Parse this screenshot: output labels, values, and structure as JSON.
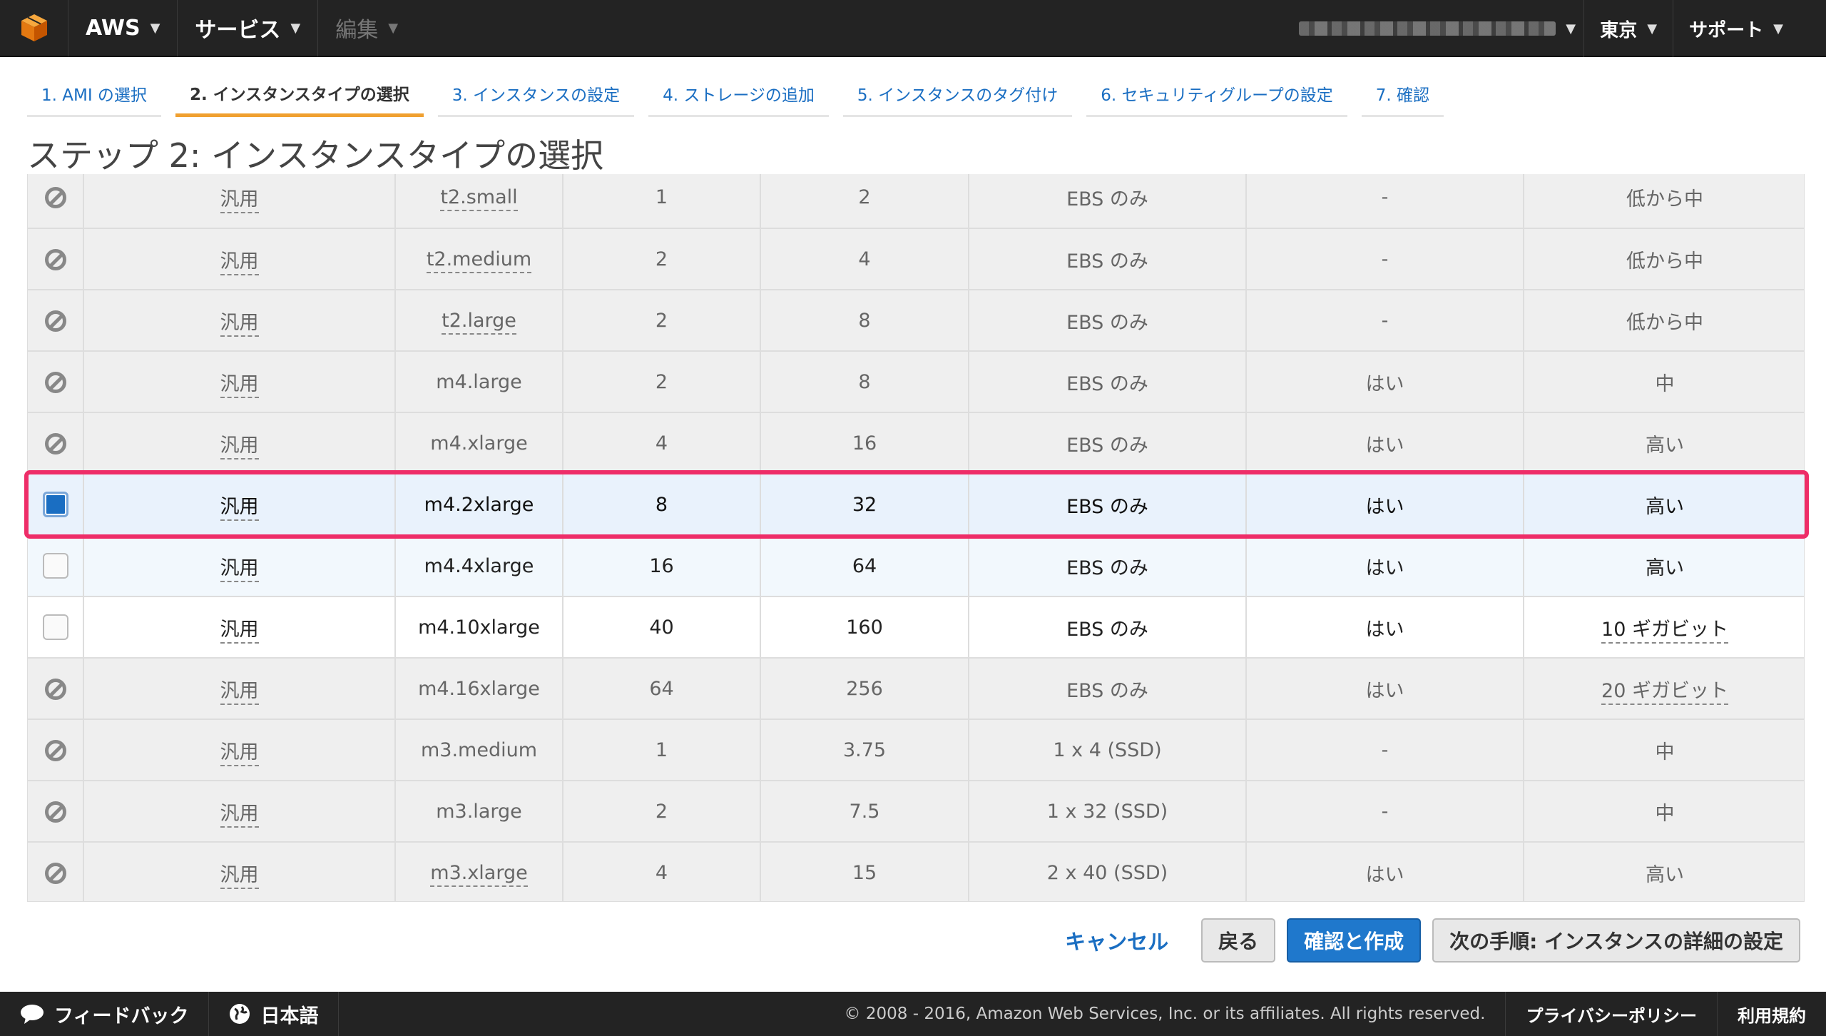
{
  "nav": {
    "aws_label": "AWS",
    "services_label": "サービス",
    "edit_label": "編集",
    "region_label": "東京",
    "support_label": "サポート"
  },
  "steps": [
    "1. AMI の選択",
    "2. インスタンスタイプの選択",
    "3. インスタンスの設定",
    "4. ストレージの追加",
    "5. インスタンスのタグ付け",
    "6. セキュリティグループの設定",
    "7. 確認"
  ],
  "page_title": "ステップ 2: インスタンスタイプの選択",
  "rows": [
    {
      "state": "disabled",
      "family": "汎用",
      "type": "t2.small",
      "vcpu": "1",
      "memory": "2",
      "storage": "EBS のみ",
      "ebs_opt": "-",
      "network": "低から中"
    },
    {
      "state": "disabled",
      "family": "汎用",
      "type": "t2.medium",
      "vcpu": "2",
      "memory": "4",
      "storage": "EBS のみ",
      "ebs_opt": "-",
      "network": "低から中"
    },
    {
      "state": "disabled",
      "family": "汎用",
      "type": "t2.large",
      "vcpu": "2",
      "memory": "8",
      "storage": "EBS のみ",
      "ebs_opt": "-",
      "network": "低から中"
    },
    {
      "state": "disabled",
      "family": "汎用",
      "type": "m4.large",
      "vcpu": "2",
      "memory": "8",
      "storage": "EBS のみ",
      "ebs_opt": "はい",
      "network": "中"
    },
    {
      "state": "disabled",
      "family": "汎用",
      "type": "m4.xlarge",
      "vcpu": "4",
      "memory": "16",
      "storage": "EBS のみ",
      "ebs_opt": "はい",
      "network": "高い"
    },
    {
      "state": "selected",
      "family": "汎用",
      "type": "m4.2xlarge",
      "vcpu": "8",
      "memory": "32",
      "storage": "EBS のみ",
      "ebs_opt": "はい",
      "network": "高い"
    },
    {
      "state": "hover",
      "family": "汎用",
      "type": "m4.4xlarge",
      "vcpu": "16",
      "memory": "64",
      "storage": "EBS のみ",
      "ebs_opt": "はい",
      "network": "高い"
    },
    {
      "state": "normal",
      "family": "汎用",
      "type": "m4.10xlarge",
      "vcpu": "40",
      "memory": "160",
      "storage": "EBS のみ",
      "ebs_opt": "はい",
      "network": "10 ギガビット"
    },
    {
      "state": "disabled",
      "family": "汎用",
      "type": "m4.16xlarge",
      "vcpu": "64",
      "memory": "256",
      "storage": "EBS のみ",
      "ebs_opt": "はい",
      "network": "20 ギガビット"
    },
    {
      "state": "disabled",
      "family": "汎用",
      "type": "m3.medium",
      "vcpu": "1",
      "memory": "3.75",
      "storage": "1 x 4 (SSD)",
      "ebs_opt": "-",
      "network": "中"
    },
    {
      "state": "disabled",
      "family": "汎用",
      "type": "m3.large",
      "vcpu": "2",
      "memory": "7.5",
      "storage": "1 x 32 (SSD)",
      "ebs_opt": "-",
      "network": "中"
    },
    {
      "state": "disabled",
      "family": "汎用",
      "type": "m3.xlarge",
      "vcpu": "4",
      "memory": "15",
      "storage": "2 x 40 (SSD)",
      "ebs_opt": "はい",
      "network": "高い"
    }
  ],
  "buttons": {
    "cancel": "キャンセル",
    "back": "戻る",
    "review_launch": "確認と作成",
    "next": "次の手順: インスタンスの詳細の設定"
  },
  "footer": {
    "feedback": "フィードバック",
    "language": "日本語",
    "copyright": "© 2008 - 2016, Amazon Web Services, Inc. or its affiliates. All rights reserved.",
    "privacy": "プライバシーポリシー",
    "terms": "利用規約"
  },
  "colors": {
    "nav_bg": "#232323",
    "link": "#1a6ec2",
    "active_step": "#f0a030",
    "highlight": "#ee2d68",
    "primary_button": "#1f78cc"
  }
}
